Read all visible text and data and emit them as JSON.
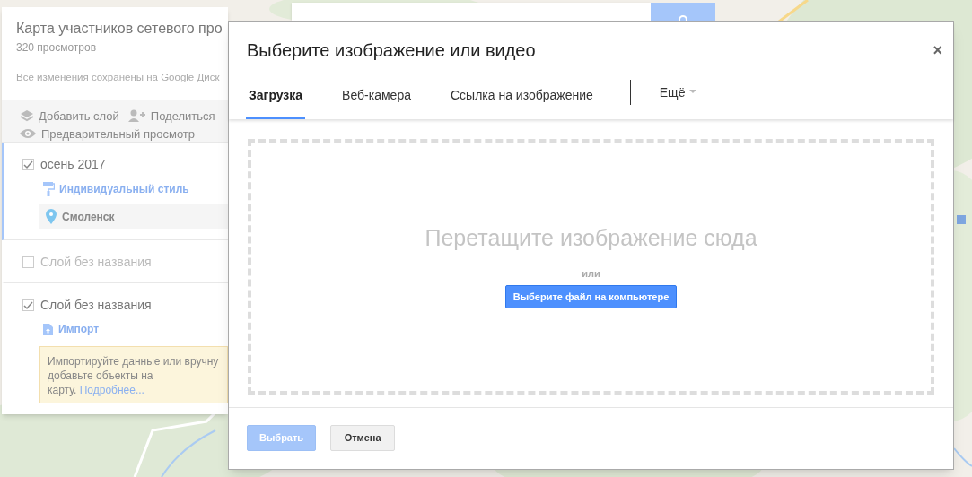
{
  "map_panel": {
    "title": "Карта участников сетевого про",
    "views": "320 просмотров",
    "save_status": "Все изменения сохранены на Google Диск",
    "actions": [
      {
        "kind": "add-layer",
        "label": "Добавить слой"
      },
      {
        "kind": "share",
        "label": "Поделиться"
      },
      {
        "kind": "preview",
        "label": "Предварительный просмотр"
      }
    ],
    "layers": [
      {
        "name": "осень 2017",
        "checked": true,
        "selected": true,
        "style_link": "Индивидуальный стиль",
        "places": [
          "Смоленск"
        ]
      },
      {
        "name": "Слой без названия",
        "checked": false,
        "selected": false
      },
      {
        "name": "Слой без названия",
        "checked": true,
        "selected": false,
        "import_link": "Импорт",
        "hint": "Импортируйте данные или вручну\nдобавьте объекты на\nкарту. ",
        "hint_link": "Подробнее..."
      }
    ]
  },
  "dialog": {
    "title": "Выберите изображение или видео",
    "close": "×",
    "tabs": [
      {
        "label": "Загрузка",
        "selected": true
      },
      {
        "label": "Веб-камера",
        "selected": false
      },
      {
        "label": "Ссылка на изображение",
        "selected": false
      }
    ],
    "more": "Ещё",
    "drop_zone": {
      "prompt": "Перетащите изображение сюда",
      "or": "или",
      "button": "Выберите файл на компьютере"
    },
    "buttons": [
      {
        "label": "Выбрать",
        "kind": "primary",
        "disabled": true
      },
      {
        "label": "Отмена",
        "kind": "secondary",
        "disabled": false
      }
    ]
  }
}
